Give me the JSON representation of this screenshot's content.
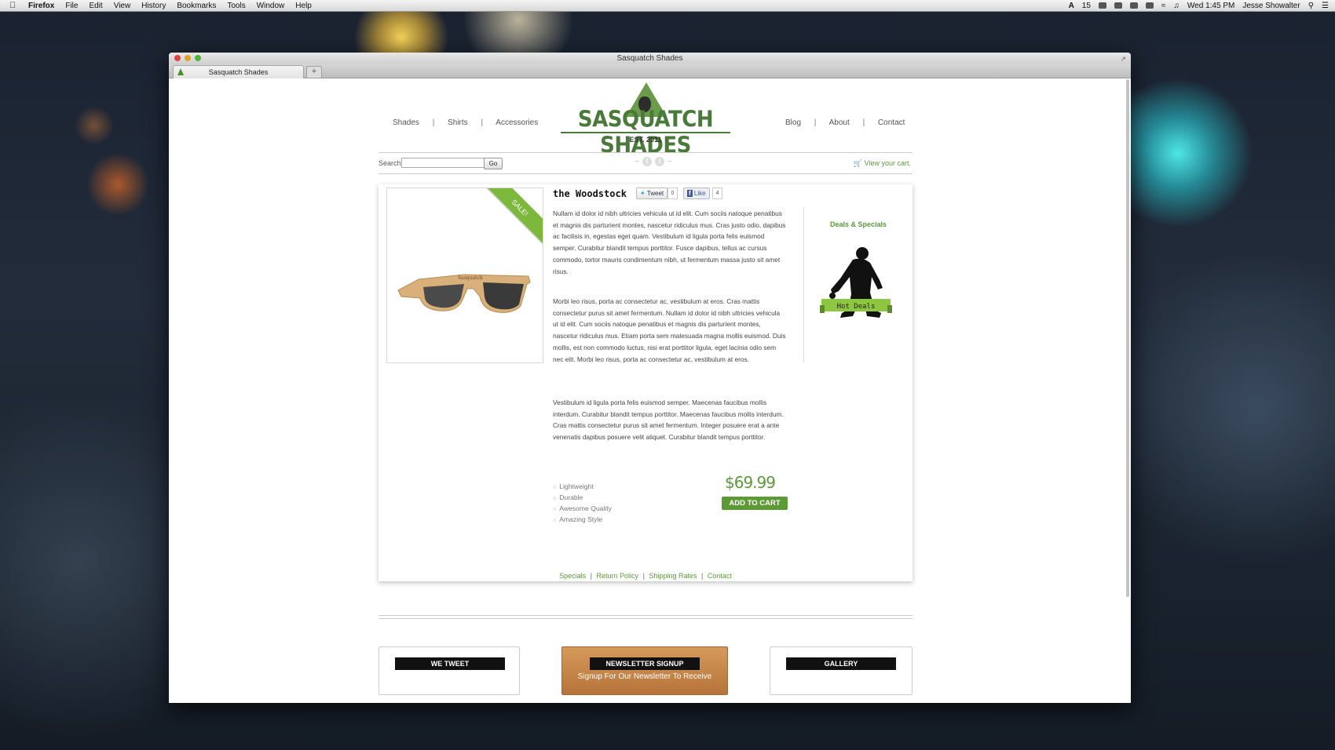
{
  "menubar": {
    "app": "Firefox",
    "items": [
      "File",
      "Edit",
      "View",
      "History",
      "Bookmarks",
      "Tools",
      "Window",
      "Help"
    ],
    "battery": "15",
    "clock": "Wed 1:45 PM",
    "user": "Jesse Showalter"
  },
  "window": {
    "title": "Sasquatch Shades",
    "tab_title": "Sasquatch Shades",
    "new_tab": "+"
  },
  "site": {
    "nav_left": [
      "Shades",
      "Shirts",
      "Accessories"
    ],
    "nav_right": [
      "Blog",
      "About",
      "Contact"
    ],
    "nav_sep": "|",
    "logo_name": "SASQUATCH SHADES",
    "logo_est": "EST. 2011",
    "search_label": "Search",
    "search_value": "",
    "go_label": "Go",
    "cart_link": "View your cart.",
    "social": [
      "f",
      "t"
    ]
  },
  "product": {
    "badge": "SALE!",
    "title": "the Woodstock",
    "tweet_label": "Tweet",
    "tweet_count": "0",
    "like_label": "Like",
    "like_count": "4",
    "desc1": "Nullam id dolor id nibh ultricies vehicula ut id elit. Cum sociis natoque penatibus et magnis dis parturient montes, nascetur ridiculus mus. Cras justo odio, dapibus ac facilisis in, egestas eget quam. Vestibulum id ligula porta felis euismod semper. Curabitur blandit tempus porttitor. Fusce dapibus, tellus ac cursus commodo, tortor mauris condimentum nibh, ut fermentum massa justo sit amet risus.",
    "desc2": "Morbi leo risus, porta ac consectetur ac, vestibulum at eros. Cras mattis consectetur purus sit amet fermentum. Nullam id dolor id nibh ultricies vehicula ut id elit. Cum sociis natoque penatibus et magnis dis parturient montes, nascetur ridiculus mus. Etiam porta sem malesuada magna mollis euismod. Duis mollis, est non commodo luctus, nisi erat porttitor ligula, eget lacinia odio sem nec elit. Morbi leo risus, porta ac consectetur ac, vestibulum at eros.",
    "desc3": "Vestibulum id ligula porta felis euismod semper. Maecenas faucibus mollis interdum. Curabitur blandit tempus porttitor. Maecenas faucibus mollis interdum. Cras mattis consectetur purus sit amet fermentum. Integer posuere erat a ante venenatis dapibus posuere velit aliquet. Curabitur blandit tempus porttitor.",
    "features": [
      "Lightweight",
      "Durable",
      "Awesome Quality",
      "Amazing Style"
    ],
    "price": "$69.99",
    "add_to_cart": "ADD TO CART",
    "glasses_logo": "Sasquatch"
  },
  "sidebar": {
    "title": "Deals & Specials",
    "hot_deals": "Hot Deals"
  },
  "footer_links": [
    "Specials",
    "Return Policy",
    "Shipping Rates",
    "Contact"
  ],
  "bottom_boxes": {
    "tweet": "WE TWEET",
    "newsletter": "NEWSLETTER SIGNUP",
    "newsletter_sub": "Signup For Our Newsletter To Receive",
    "gallery": "GALLERY"
  },
  "colors": {
    "brand_green": "#5a9a3a",
    "sale_green": "#7bb83b",
    "button_green": "#5d9a36"
  }
}
